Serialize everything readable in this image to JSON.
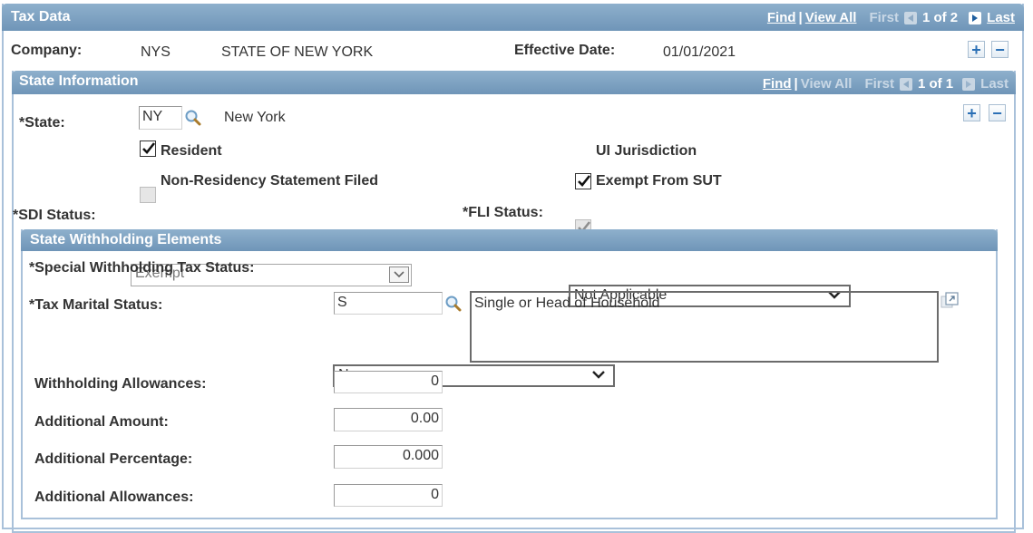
{
  "tax_data": {
    "title": "Tax Data",
    "nav": {
      "find": "Find",
      "sep": "|",
      "view_all": "View All",
      "first": "First",
      "count": "1 of 2",
      "last": "Last"
    },
    "company_label": "Company:",
    "company_code": "NYS",
    "company_name": "STATE OF NEW YORK",
    "effective_date_label": "Effective Date:",
    "effective_date": "01/01/2021",
    "add": "+",
    "delete": "−"
  },
  "state_info": {
    "title": "State Information",
    "nav": {
      "find": "Find",
      "sep": "|",
      "view_all": "View All",
      "first": "First",
      "count": "1 of 1",
      "last": "Last"
    },
    "add": "+",
    "delete": "−",
    "state_label": "*State:",
    "state_value": "NY",
    "state_name": "New York",
    "resident": {
      "label": "Resident",
      "checked": true
    },
    "non_residency": {
      "label": "Non-Residency Statement Filed",
      "checked": false
    },
    "ui_jurisdiction": {
      "label": "UI Jurisdiction",
      "checked": true
    },
    "exempt_sut": {
      "label": "Exempt From SUT",
      "checked": true
    },
    "sdi_label": "*SDI Status:",
    "sdi_value": "Exempt",
    "fli_label": "*FLI Status:",
    "fli_value": "Not Applicable"
  },
  "withholding": {
    "title": "State Withholding Elements",
    "special_label": "*Special Withholding Tax Status:",
    "special_value": "None",
    "marital_label": "*Tax Marital Status:",
    "marital_value": "S",
    "marital_desc": "Single or Head of Household",
    "allowances_label": "Withholding Allowances:",
    "allowances_value": "0",
    "add_amount_label": "Additional Amount:",
    "add_amount_value": "0.00",
    "add_pct_label": "Additional Percentage:",
    "add_pct_value": "0.000",
    "add_allow_label": "Additional Allowances:",
    "add_allow_value": "0"
  },
  "colors": {
    "header_top": "#8eb0cc",
    "header_bottom": "#6f95b8",
    "frame": "#a9c1da",
    "icon_blue": "#2a6fb5"
  }
}
